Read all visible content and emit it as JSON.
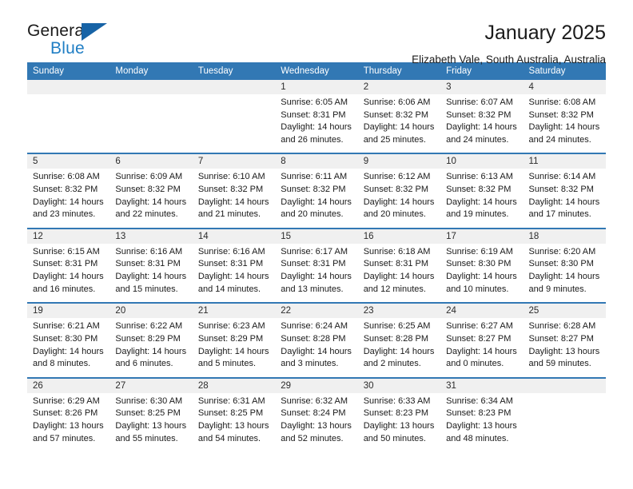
{
  "brand": {
    "word1": "General",
    "word2": "Blue",
    "triangle_color": "#1763a6",
    "blue_color": "#1f7ec4"
  },
  "header": {
    "title": "January 2025",
    "subtitle": "Elizabeth Vale, South Australia, Australia",
    "header_bg": "#3278b4"
  },
  "calendar": {
    "weekday_headers": [
      "Sunday",
      "Monday",
      "Tuesday",
      "Wednesday",
      "Thursday",
      "Friday",
      "Saturday"
    ],
    "weeks": [
      [
        {
          "day": "",
          "empty": true
        },
        {
          "day": "",
          "empty": true
        },
        {
          "day": "",
          "empty": true
        },
        {
          "day": "1",
          "sunrise": "Sunrise: 6:05 AM",
          "sunset": "Sunset: 8:31 PM",
          "daylight1": "Daylight: 14 hours",
          "daylight2": "and 26 minutes."
        },
        {
          "day": "2",
          "sunrise": "Sunrise: 6:06 AM",
          "sunset": "Sunset: 8:32 PM",
          "daylight1": "Daylight: 14 hours",
          "daylight2": "and 25 minutes."
        },
        {
          "day": "3",
          "sunrise": "Sunrise: 6:07 AM",
          "sunset": "Sunset: 8:32 PM",
          "daylight1": "Daylight: 14 hours",
          "daylight2": "and 24 minutes."
        },
        {
          "day": "4",
          "sunrise": "Sunrise: 6:08 AM",
          "sunset": "Sunset: 8:32 PM",
          "daylight1": "Daylight: 14 hours",
          "daylight2": "and 24 minutes."
        }
      ],
      [
        {
          "day": "5",
          "sunrise": "Sunrise: 6:08 AM",
          "sunset": "Sunset: 8:32 PM",
          "daylight1": "Daylight: 14 hours",
          "daylight2": "and 23 minutes."
        },
        {
          "day": "6",
          "sunrise": "Sunrise: 6:09 AM",
          "sunset": "Sunset: 8:32 PM",
          "daylight1": "Daylight: 14 hours",
          "daylight2": "and 22 minutes."
        },
        {
          "day": "7",
          "sunrise": "Sunrise: 6:10 AM",
          "sunset": "Sunset: 8:32 PM",
          "daylight1": "Daylight: 14 hours",
          "daylight2": "and 21 minutes."
        },
        {
          "day": "8",
          "sunrise": "Sunrise: 6:11 AM",
          "sunset": "Sunset: 8:32 PM",
          "daylight1": "Daylight: 14 hours",
          "daylight2": "and 20 minutes."
        },
        {
          "day": "9",
          "sunrise": "Sunrise: 6:12 AM",
          "sunset": "Sunset: 8:32 PM",
          "daylight1": "Daylight: 14 hours",
          "daylight2": "and 20 minutes."
        },
        {
          "day": "10",
          "sunrise": "Sunrise: 6:13 AM",
          "sunset": "Sunset: 8:32 PM",
          "daylight1": "Daylight: 14 hours",
          "daylight2": "and 19 minutes."
        },
        {
          "day": "11",
          "sunrise": "Sunrise: 6:14 AM",
          "sunset": "Sunset: 8:32 PM",
          "daylight1": "Daylight: 14 hours",
          "daylight2": "and 17 minutes."
        }
      ],
      [
        {
          "day": "12",
          "sunrise": "Sunrise: 6:15 AM",
          "sunset": "Sunset: 8:31 PM",
          "daylight1": "Daylight: 14 hours",
          "daylight2": "and 16 minutes."
        },
        {
          "day": "13",
          "sunrise": "Sunrise: 6:16 AM",
          "sunset": "Sunset: 8:31 PM",
          "daylight1": "Daylight: 14 hours",
          "daylight2": "and 15 minutes."
        },
        {
          "day": "14",
          "sunrise": "Sunrise: 6:16 AM",
          "sunset": "Sunset: 8:31 PM",
          "daylight1": "Daylight: 14 hours",
          "daylight2": "and 14 minutes."
        },
        {
          "day": "15",
          "sunrise": "Sunrise: 6:17 AM",
          "sunset": "Sunset: 8:31 PM",
          "daylight1": "Daylight: 14 hours",
          "daylight2": "and 13 minutes."
        },
        {
          "day": "16",
          "sunrise": "Sunrise: 6:18 AM",
          "sunset": "Sunset: 8:31 PM",
          "daylight1": "Daylight: 14 hours",
          "daylight2": "and 12 minutes."
        },
        {
          "day": "17",
          "sunrise": "Sunrise: 6:19 AM",
          "sunset": "Sunset: 8:30 PM",
          "daylight1": "Daylight: 14 hours",
          "daylight2": "and 10 minutes."
        },
        {
          "day": "18",
          "sunrise": "Sunrise: 6:20 AM",
          "sunset": "Sunset: 8:30 PM",
          "daylight1": "Daylight: 14 hours",
          "daylight2": "and 9 minutes."
        }
      ],
      [
        {
          "day": "19",
          "sunrise": "Sunrise: 6:21 AM",
          "sunset": "Sunset: 8:30 PM",
          "daylight1": "Daylight: 14 hours",
          "daylight2": "and 8 minutes."
        },
        {
          "day": "20",
          "sunrise": "Sunrise: 6:22 AM",
          "sunset": "Sunset: 8:29 PM",
          "daylight1": "Daylight: 14 hours",
          "daylight2": "and 6 minutes."
        },
        {
          "day": "21",
          "sunrise": "Sunrise: 6:23 AM",
          "sunset": "Sunset: 8:29 PM",
          "daylight1": "Daylight: 14 hours",
          "daylight2": "and 5 minutes."
        },
        {
          "day": "22",
          "sunrise": "Sunrise: 6:24 AM",
          "sunset": "Sunset: 8:28 PM",
          "daylight1": "Daylight: 14 hours",
          "daylight2": "and 3 minutes."
        },
        {
          "day": "23",
          "sunrise": "Sunrise: 6:25 AM",
          "sunset": "Sunset: 8:28 PM",
          "daylight1": "Daylight: 14 hours",
          "daylight2": "and 2 minutes."
        },
        {
          "day": "24",
          "sunrise": "Sunrise: 6:27 AM",
          "sunset": "Sunset: 8:27 PM",
          "daylight1": "Daylight: 14 hours",
          "daylight2": "and 0 minutes."
        },
        {
          "day": "25",
          "sunrise": "Sunrise: 6:28 AM",
          "sunset": "Sunset: 8:27 PM",
          "daylight1": "Daylight: 13 hours",
          "daylight2": "and 59 minutes."
        }
      ],
      [
        {
          "day": "26",
          "sunrise": "Sunrise: 6:29 AM",
          "sunset": "Sunset: 8:26 PM",
          "daylight1": "Daylight: 13 hours",
          "daylight2": "and 57 minutes."
        },
        {
          "day": "27",
          "sunrise": "Sunrise: 6:30 AM",
          "sunset": "Sunset: 8:25 PM",
          "daylight1": "Daylight: 13 hours",
          "daylight2": "and 55 minutes."
        },
        {
          "day": "28",
          "sunrise": "Sunrise: 6:31 AM",
          "sunset": "Sunset: 8:25 PM",
          "daylight1": "Daylight: 13 hours",
          "daylight2": "and 54 minutes."
        },
        {
          "day": "29",
          "sunrise": "Sunrise: 6:32 AM",
          "sunset": "Sunset: 8:24 PM",
          "daylight1": "Daylight: 13 hours",
          "daylight2": "and 52 minutes."
        },
        {
          "day": "30",
          "sunrise": "Sunrise: 6:33 AM",
          "sunset": "Sunset: 8:23 PM",
          "daylight1": "Daylight: 13 hours",
          "daylight2": "and 50 minutes."
        },
        {
          "day": "31",
          "sunrise": "Sunrise: 6:34 AM",
          "sunset": "Sunset: 8:23 PM",
          "daylight1": "Daylight: 13 hours",
          "daylight2": "and 48 minutes."
        },
        {
          "day": "",
          "empty": true
        }
      ]
    ]
  }
}
